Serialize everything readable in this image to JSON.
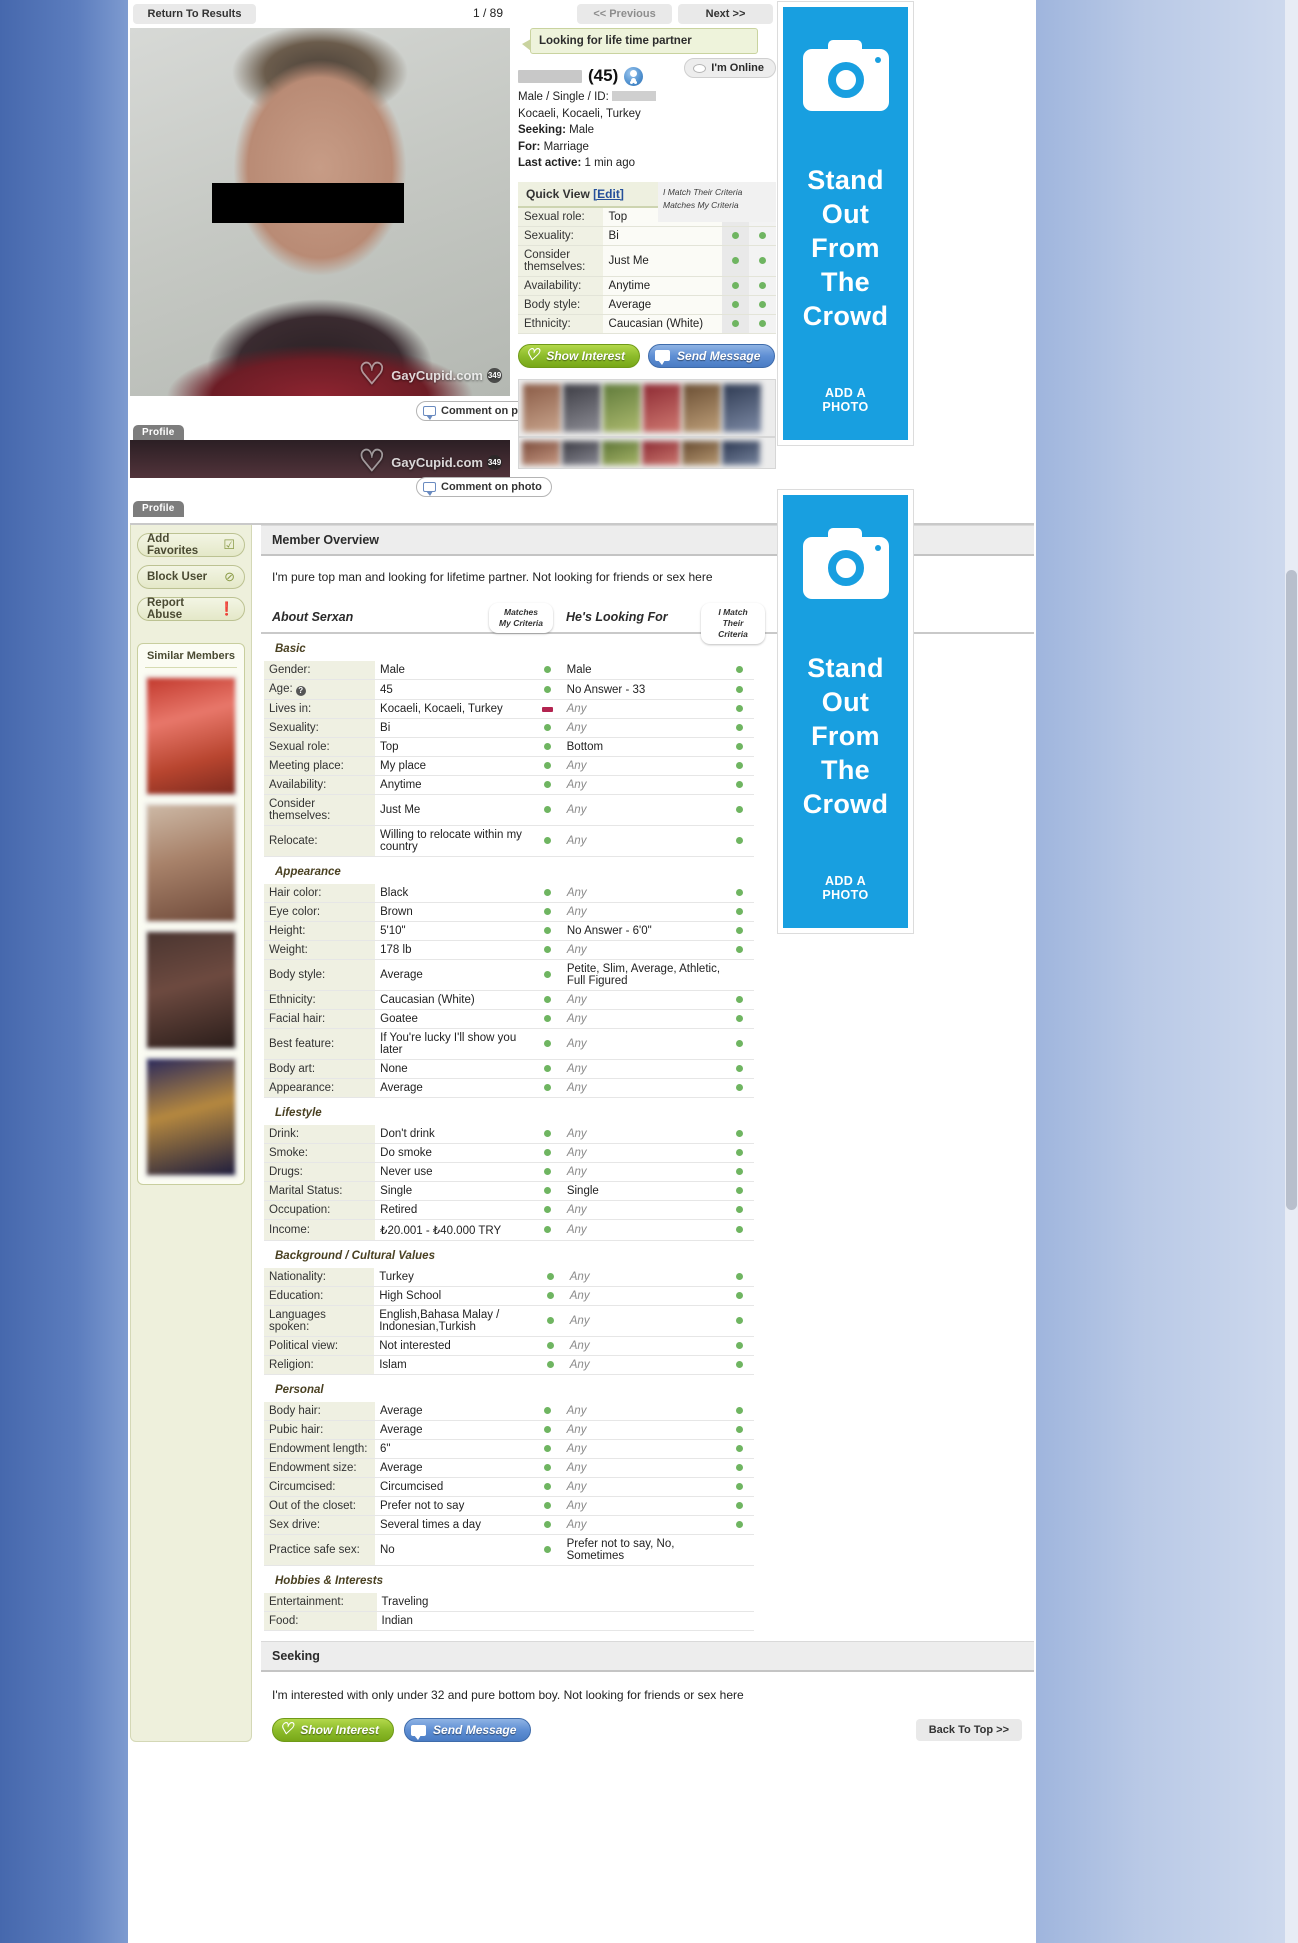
{
  "topnav": {
    "return_label": "Return To Results",
    "counter": "1 / 89",
    "prev_label": "<< Previous",
    "next_label": "Next >>"
  },
  "photos": {
    "watermark": "GayCupid.com",
    "watermark_count": "349",
    "comment_label": "Comment on photo",
    "tab_label": "Profile"
  },
  "profile": {
    "tagline": "Looking for life time partner",
    "age": "(45)",
    "online_label": "I'm Online",
    "gender_status": "Male / Single / ID:",
    "location": "Kocaeli, Kocaeli, Turkey",
    "seeking_label": "Seeking:",
    "seeking_value": "Male",
    "for_label": "For:",
    "for_value": "Marriage",
    "last_active_label": "Last active:",
    "last_active_value": "1 min ago"
  },
  "quick_view": {
    "title": "Quick View",
    "edit_label": "[Edit]",
    "col_i_match": "I Match Their Criteria",
    "col_matches_my": "Matches My Criteria",
    "rows": [
      {
        "key": "Sexual role:",
        "value": "Top"
      },
      {
        "key": "Sexuality:",
        "value": "Bi"
      },
      {
        "key": "Consider themselves:",
        "value": "Just Me"
      },
      {
        "key": "Availability:",
        "value": "Anytime"
      },
      {
        "key": "Body style:",
        "value": "Average"
      },
      {
        "key": "Ethnicity:",
        "value": "Caucasian (White)"
      }
    ]
  },
  "actions": {
    "show_interest": "Show Interest",
    "send_message": "Send Message"
  },
  "left_rail": {
    "buttons": [
      {
        "label": "Add Favorites",
        "icon": "checkbox-icon"
      },
      {
        "label": "Block User",
        "icon": "block-icon"
      },
      {
        "label": "Report Abuse",
        "icon": "warning-icon"
      }
    ],
    "similar_title": "Similar Members"
  },
  "overview": {
    "heading": "Member Overview",
    "text": "I'm pure top man and looking for lifetime partner. Not looking for friends or sex here"
  },
  "criteria": {
    "about_title": "About Serxan",
    "looking_title": "He's Looking For",
    "pill_matches_my": "Matches My Criteria",
    "pill_i_match": "I Match Their Criteria"
  },
  "sections": [
    {
      "group": "Basic",
      "rows": [
        {
          "key": "Gender:",
          "value": "Male",
          "match": "green",
          "want": "Male",
          "want_any": false,
          "match2": "green"
        },
        {
          "key": "Age:",
          "value": "45",
          "match": "green",
          "want": "No Answer - 33",
          "want_any": false,
          "match2": "green",
          "help": true
        },
        {
          "key": "Lives in:",
          "value": "Kocaeli, Kocaeli, Turkey",
          "match": "red",
          "want": "Any",
          "want_any": true,
          "match2": "green"
        },
        {
          "key": "Sexuality:",
          "value": "Bi",
          "match": "green",
          "want": "Any",
          "want_any": true,
          "match2": "green"
        },
        {
          "key": "Sexual role:",
          "value": "Top",
          "match": "green",
          "want": "Bottom",
          "want_any": false,
          "match2": "green"
        },
        {
          "key": "Meeting place:",
          "value": "My place",
          "match": "green",
          "want": "Any",
          "want_any": true,
          "match2": "green"
        },
        {
          "key": "Availability:",
          "value": "Anytime",
          "match": "green",
          "want": "Any",
          "want_any": true,
          "match2": "green"
        },
        {
          "key": "Consider themselves:",
          "value": "Just Me",
          "match": "green",
          "want": "Any",
          "want_any": true,
          "match2": "green"
        },
        {
          "key": "Relocate:",
          "value": "Willing to relocate within my country",
          "match": "green",
          "want": "Any",
          "want_any": true,
          "match2": "green"
        }
      ]
    },
    {
      "group": "Appearance",
      "rows": [
        {
          "key": "Hair color:",
          "value": "Black",
          "match": "green",
          "want": "Any",
          "want_any": true,
          "match2": "green"
        },
        {
          "key": "Eye color:",
          "value": "Brown",
          "match": "green",
          "want": "Any",
          "want_any": true,
          "match2": "green"
        },
        {
          "key": "Height:",
          "value": "5'10\"",
          "match": "green",
          "want": "No Answer - 6'0\"",
          "want_any": false,
          "match2": "green"
        },
        {
          "key": "Weight:",
          "value": "178 lb",
          "match": "green",
          "want": "Any",
          "want_any": true,
          "match2": "green"
        },
        {
          "key": "Body style:",
          "value": "Average",
          "match": "green",
          "want": "Petite, Slim, Average, Athletic, Full Figured",
          "want_any": false,
          "match2": ""
        },
        {
          "key": "Ethnicity:",
          "value": "Caucasian (White)",
          "match": "green",
          "want": "Any",
          "want_any": true,
          "match2": "green"
        },
        {
          "key": "Facial hair:",
          "value": "Goatee",
          "match": "green",
          "want": "Any",
          "want_any": true,
          "match2": "green"
        },
        {
          "key": "Best feature:",
          "value": "If You're lucky I'll show you later",
          "match": "green",
          "want": "Any",
          "want_any": true,
          "match2": "green"
        },
        {
          "key": "Body art:",
          "value": "None",
          "match": "green",
          "want": "Any",
          "want_any": true,
          "match2": "green"
        },
        {
          "key": "Appearance:",
          "value": "Average",
          "match": "green",
          "want": "Any",
          "want_any": true,
          "match2": "green"
        }
      ]
    },
    {
      "group": "Lifestyle",
      "rows": [
        {
          "key": "Drink:",
          "value": "Don't drink",
          "match": "green",
          "want": "Any",
          "want_any": true,
          "match2": "green"
        },
        {
          "key": "Smoke:",
          "value": "Do smoke",
          "match": "green",
          "want": "Any",
          "want_any": true,
          "match2": "green"
        },
        {
          "key": "Drugs:",
          "value": "Never use",
          "match": "green",
          "want": "Any",
          "want_any": true,
          "match2": "green"
        },
        {
          "key": "Marital Status:",
          "value": "Single",
          "match": "green",
          "want": "Single",
          "want_any": false,
          "match2": "green"
        },
        {
          "key": "Occupation:",
          "value": "Retired",
          "match": "green",
          "want": "Any",
          "want_any": true,
          "match2": "green"
        },
        {
          "key": "Income:",
          "value": "₺20.001 - ₺40.000 TRY",
          "match": "green",
          "want": "Any",
          "want_any": true,
          "match2": "green"
        }
      ]
    },
    {
      "group": "Background / Cultural Values",
      "rows": [
        {
          "key": "Nationality:",
          "value": "Turkey",
          "match": "green",
          "want": "Any",
          "want_any": true,
          "match2": "green"
        },
        {
          "key": "Education:",
          "value": "High School",
          "match": "green",
          "want": "Any",
          "want_any": true,
          "match2": "green"
        },
        {
          "key": "Languages spoken:",
          "value": "English,Bahasa Malay / Indonesian,Turkish",
          "match": "green",
          "want": "Any",
          "want_any": true,
          "match2": "green"
        },
        {
          "key": "Political view:",
          "value": "Not interested",
          "match": "green",
          "want": "Any",
          "want_any": true,
          "match2": "green"
        },
        {
          "key": "Religion:",
          "value": "Islam",
          "match": "green",
          "want": "Any",
          "want_any": true,
          "match2": "green"
        }
      ]
    },
    {
      "group": "Personal",
      "rows": [
        {
          "key": "Body hair:",
          "value": "Average",
          "match": "green",
          "want": "Any",
          "want_any": true,
          "match2": "green"
        },
        {
          "key": "Pubic hair:",
          "value": "Average",
          "match": "green",
          "want": "Any",
          "want_any": true,
          "match2": "green"
        },
        {
          "key": "Endowment length:",
          "value": "6\"",
          "match": "green",
          "want": "Any",
          "want_any": true,
          "match2": "green"
        },
        {
          "key": "Endowment size:",
          "value": "Average",
          "match": "green",
          "want": "Any",
          "want_any": true,
          "match2": "green"
        },
        {
          "key": "Circumcised:",
          "value": "Circumcised",
          "match": "green",
          "want": "Any",
          "want_any": true,
          "match2": "green"
        },
        {
          "key": "Out of the closet:",
          "value": "Prefer not to say",
          "match": "green",
          "want": "Any",
          "want_any": true,
          "match2": "green"
        },
        {
          "key": "Sex drive:",
          "value": "Several times a day",
          "match": "green",
          "want": "Any",
          "want_any": true,
          "match2": "green"
        },
        {
          "key": "Practice safe sex:",
          "value": "No",
          "match": "green",
          "want": "Prefer not to say, No, Sometimes",
          "want_any": false,
          "match2": ""
        }
      ]
    },
    {
      "group": "Hobbies & Interests",
      "rows": [
        {
          "key": "Entertainment:",
          "value": "Traveling",
          "match": "",
          "want": "",
          "want_any": false,
          "match2": ""
        },
        {
          "key": "Food:",
          "value": "Indian",
          "match": "",
          "want": "",
          "want_any": false,
          "match2": ""
        }
      ]
    }
  ],
  "seeking": {
    "heading": "Seeking",
    "text": "I'm interested with only under 32 and pure bottom boy. Not looking for friends or sex here",
    "back_to_top": "Back To Top >>"
  },
  "ads": [
    {
      "line1": "Stand Out",
      "line2": "From The",
      "line3": "Crowd",
      "button": "ADD A PHOTO",
      "color": "#189fe0"
    },
    {
      "line1": "Stand Out",
      "line2": "From The",
      "line3": "Crowd",
      "button": "ADD A PHOTO",
      "color": "#189fe0"
    }
  ]
}
